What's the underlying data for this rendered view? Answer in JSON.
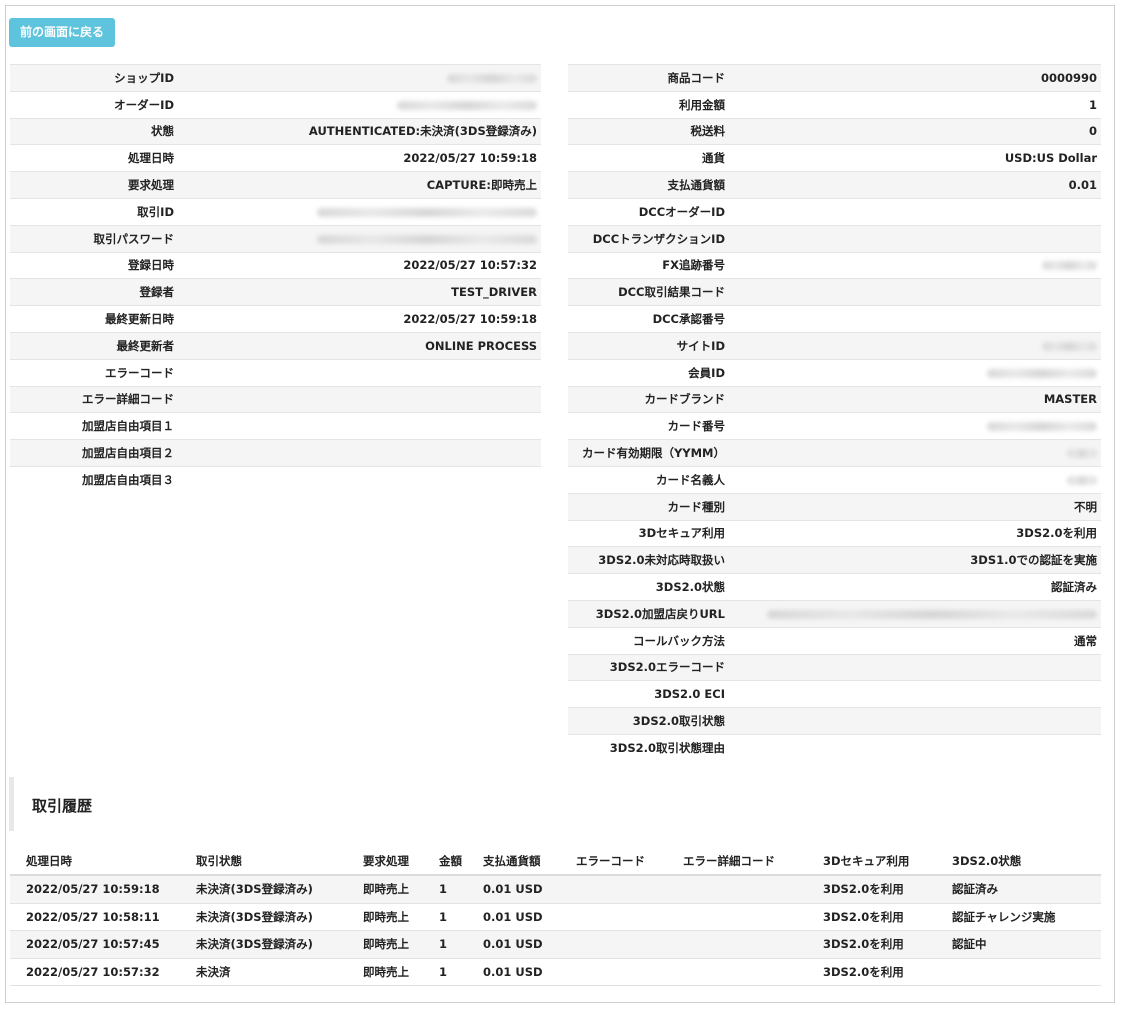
{
  "back_button": "前の画面に戻る",
  "left_details": [
    {
      "label": "ショップID",
      "value": "",
      "masked": true
    },
    {
      "label": "オーダーID",
      "value": "",
      "masked": true
    },
    {
      "label": "状態",
      "value": "AUTHENTICATED:未決済(3DS登録済み)"
    },
    {
      "label": "処理日時",
      "value": "2022/05/27 10:59:18"
    },
    {
      "label": "要求処理",
      "value": "CAPTURE:即時売上"
    },
    {
      "label": "取引ID",
      "value": "",
      "masked": true
    },
    {
      "label": "取引パスワード",
      "value": "",
      "masked": true
    },
    {
      "label": "登録日時",
      "value": "2022/05/27 10:57:32"
    },
    {
      "label": "登録者",
      "value": "TEST_DRIVER"
    },
    {
      "label": "最終更新日時",
      "value": "2022/05/27 10:59:18"
    },
    {
      "label": "最終更新者",
      "value": "ONLINE PROCESS"
    },
    {
      "label": "エラーコード",
      "value": ""
    },
    {
      "label": "エラー詳細コード",
      "value": ""
    },
    {
      "label": "加盟店自由項目１",
      "value": ""
    },
    {
      "label": "加盟店自由項目２",
      "value": ""
    },
    {
      "label": "加盟店自由項目３",
      "value": ""
    }
  ],
  "right_details": [
    {
      "label": "商品コード",
      "value": "0000990"
    },
    {
      "label": "利用金額",
      "value": "1"
    },
    {
      "label": "税送料",
      "value": "0"
    },
    {
      "label": "通貨",
      "value": "USD:US Dollar"
    },
    {
      "label": "支払通貨額",
      "value": "0.01"
    },
    {
      "label": "DCCオーダーID",
      "value": ""
    },
    {
      "label": "DCCトランザクションID",
      "value": ""
    },
    {
      "label": "FX追跡番号",
      "value": "",
      "masked": true
    },
    {
      "label": "DCC取引結果コード",
      "value": ""
    },
    {
      "label": "DCC承認番号",
      "value": ""
    },
    {
      "label": "サイトID",
      "value": "",
      "masked": true
    },
    {
      "label": "会員ID",
      "value": "",
      "masked": true
    },
    {
      "label": "カードブランド",
      "value": "MASTER"
    },
    {
      "label": "カード番号",
      "value": "",
      "masked": true
    },
    {
      "label": "カード有効期限（YYMM）",
      "value": "",
      "masked": true
    },
    {
      "label": "カード名義人",
      "value": "",
      "masked": true
    },
    {
      "label": "カード種別",
      "value": "不明"
    },
    {
      "label": "3Dセキュア利用",
      "value": "3DS2.0を利用"
    },
    {
      "label": "3DS2.0未対応時取扱い",
      "value": "3DS1.0での認証を実施"
    },
    {
      "label": "3DS2.0状態",
      "value": "認証済み"
    },
    {
      "label": "3DS2.0加盟店戻りURL",
      "value": "",
      "masked": true
    },
    {
      "label": "コールバック方法",
      "value": "通常"
    },
    {
      "label": "3DS2.0エラーコード",
      "value": ""
    },
    {
      "label": "3DS2.0 ECI",
      "value": ""
    },
    {
      "label": "3DS2.0取引状態",
      "value": ""
    },
    {
      "label": "3DS2.0取引状態理由",
      "value": ""
    }
  ],
  "history": {
    "title": "取引履歴",
    "columns": [
      "処理日時",
      "取引状態",
      "要求処理",
      "金額",
      "支払通貨額",
      "エラーコード",
      "エラー詳細コード",
      "3Dセキュア利用",
      "3DS2.0状態"
    ],
    "rows": [
      [
        "2022/05/27 10:59:18",
        "未決済(3DS登録済み)",
        "即時売上",
        "1",
        "0.01 USD",
        "",
        "",
        "3DS2.0を利用",
        "認証済み"
      ],
      [
        "2022/05/27 10:58:11",
        "未決済(3DS登録済み)",
        "即時売上",
        "1",
        "0.01 USD",
        "",
        "",
        "3DS2.0を利用",
        "認証チャレンジ実施"
      ],
      [
        "2022/05/27 10:57:45",
        "未決済(3DS登録済み)",
        "即時売上",
        "1",
        "0.01 USD",
        "",
        "",
        "3DS2.0を利用",
        "認証中"
      ],
      [
        "2022/05/27 10:57:32",
        "未決済",
        "即時売上",
        "1",
        "0.01 USD",
        "",
        "",
        "3DS2.0を利用",
        ""
      ]
    ]
  }
}
